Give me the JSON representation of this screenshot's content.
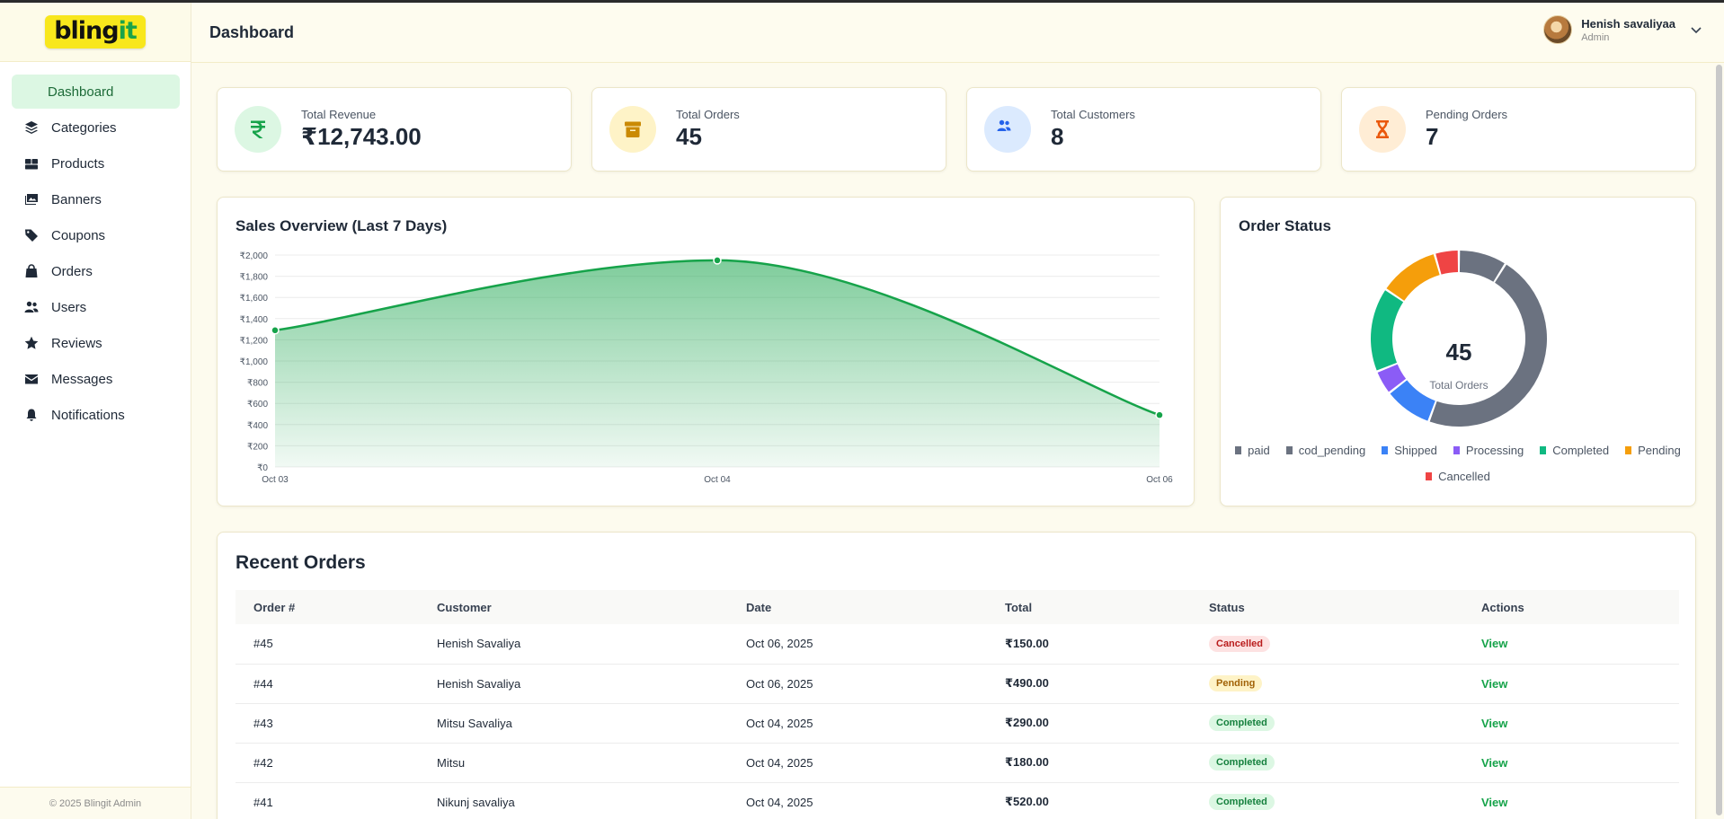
{
  "app": {
    "logo_main": "bling",
    "logo_accent": "it"
  },
  "sidebar": {
    "items": [
      {
        "label": "Dashboard",
        "icon": "home-icon",
        "active": true
      },
      {
        "label": "Categories",
        "icon": "layers-icon"
      },
      {
        "label": "Products",
        "icon": "boxes-icon"
      },
      {
        "label": "Banners",
        "icon": "images-icon"
      },
      {
        "label": "Coupons",
        "icon": "tag-icon"
      },
      {
        "label": "Orders",
        "icon": "shopping-bag-icon"
      },
      {
        "label": "Users",
        "icon": "users-icon"
      },
      {
        "label": "Reviews",
        "icon": "star-icon"
      },
      {
        "label": "Messages",
        "icon": "envelope-icon"
      },
      {
        "label": "Notifications",
        "icon": "bell-icon"
      }
    ],
    "footer": "© 2025 Blingit Admin"
  },
  "header": {
    "title": "Dashboard",
    "user_name": "Henish savaliyaa",
    "user_role": "Admin"
  },
  "stats": [
    {
      "label": "Total Revenue",
      "value": "₹12,743.00",
      "icon": "rupee-icon",
      "color": "#16a34a",
      "bg": "#dcf7e3"
    },
    {
      "label": "Total Orders",
      "value": "45",
      "icon": "archive-box-icon",
      "color": "#ca8a04",
      "bg": "#fef3c7"
    },
    {
      "label": "Total Customers",
      "value": "8",
      "icon": "users-icon",
      "color": "#2563eb",
      "bg": "#dbeafe"
    },
    {
      "label": "Pending Orders",
      "value": "7",
      "icon": "hourglass-icon",
      "color": "#ea580c",
      "bg": "#ffedd5"
    }
  ],
  "sales_chart": {
    "title": "Sales Overview (Last 7 Days)",
    "chart_data": {
      "type": "area",
      "categories": [
        "Oct 03",
        "Oct 04",
        "Oct 06"
      ],
      "values": [
        1290,
        1950,
        490
      ],
      "ylim": [
        0,
        2000
      ],
      "yticks": [
        "₹0",
        "₹200",
        "₹400",
        "₹600",
        "₹800",
        "₹1,000",
        "₹1,200",
        "₹1,400",
        "₹1,600",
        "₹1,800",
        "₹2,000"
      ],
      "grid": true,
      "color": "#16a34a"
    }
  },
  "order_status": {
    "title": "Order Status",
    "center_value": "45",
    "center_label": "Total Orders",
    "chart_data": {
      "type": "pie",
      "labels": [
        "paid",
        "cod_pending",
        "Shipped",
        "Processing",
        "Completed",
        "Pending",
        "Cancelled"
      ],
      "values": [
        4,
        21,
        4,
        2,
        7,
        5,
        2
      ],
      "colors": [
        "#6b7280",
        "#6b7280",
        "#3b82f6",
        "#8b5cf6",
        "#10b981",
        "#f59e0b",
        "#ef4444"
      ]
    }
  },
  "recent_orders": {
    "title": "Recent Orders",
    "columns": [
      "Order #",
      "Customer",
      "Date",
      "Total",
      "Status",
      "Actions"
    ],
    "rows": [
      {
        "id": "#45",
        "customer": "Henish Savaliya",
        "date": "Oct 06, 2025",
        "total": "₹150.00",
        "status": "Cancelled",
        "action": "View"
      },
      {
        "id": "#44",
        "customer": "Henish Savaliya",
        "date": "Oct 06, 2025",
        "total": "₹490.00",
        "status": "Pending",
        "action": "View"
      },
      {
        "id": "#43",
        "customer": "Mitsu Savaliya",
        "date": "Oct 04, 2025",
        "total": "₹290.00",
        "status": "Completed",
        "action": "View"
      },
      {
        "id": "#42",
        "customer": "Mitsu",
        "date": "Oct 04, 2025",
        "total": "₹180.00",
        "status": "Completed",
        "action": "View"
      },
      {
        "id": "#41",
        "customer": "Nikunj savaliya",
        "date": "Oct 04, 2025",
        "total": "₹520.00",
        "status": "Completed",
        "action": "View"
      }
    ],
    "status_colors": {
      "Cancelled": {
        "bg": "#fde2e2",
        "fg": "#b91c1c"
      },
      "Pending": {
        "bg": "#fef3c7",
        "fg": "#a16207"
      },
      "Completed": {
        "bg": "#dcf7e3",
        "fg": "#15803d"
      }
    }
  }
}
